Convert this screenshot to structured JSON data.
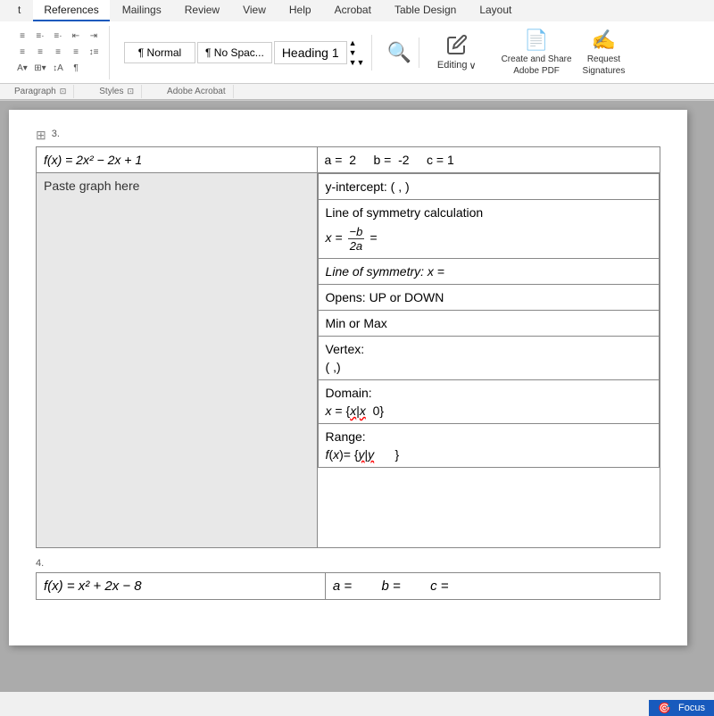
{
  "ribbon": {
    "tabs": [
      {
        "label": "t",
        "active": false
      },
      {
        "label": "References",
        "active": true
      },
      {
        "label": "Mailings",
        "active": false
      },
      {
        "label": "Review",
        "active": false
      },
      {
        "label": "View",
        "active": false
      },
      {
        "label": "Help",
        "active": false
      },
      {
        "label": "Acrobat",
        "active": false
      },
      {
        "label": "Table Design",
        "active": false
      },
      {
        "label": "Layout",
        "active": false
      }
    ],
    "styles": {
      "normal": "¶ Normal",
      "nospace": "¶ No Spac...",
      "heading": "Heading 1"
    },
    "groups": {
      "paragraph_label": "Paragraph",
      "styles_label": "Styles",
      "acrobat_label": "Adobe Acrobat"
    },
    "editing": {
      "label": "Editing",
      "chevron": "∨"
    },
    "acrobat_buttons": [
      {
        "label": "Create and Share\nAdobe PDF",
        "icon": "📄"
      },
      {
        "label": "Request\nSignatures",
        "icon": "✍"
      }
    ]
  },
  "document": {
    "row3_label": "3.",
    "row4_label": "4.",
    "problem3": {
      "function": "f(x) = 2x² − 2x + 1",
      "a_label": "a =",
      "a_value": "2",
      "b_label": "b =",
      "b_value": "-2",
      "c_label": "c =",
      "c_value": "1",
      "paste_text": "Paste graph here",
      "y_intercept_label": "y-intercept: (       ,       )",
      "symmetry_calc_label": "Line of symmetry calculation",
      "symmetry_formula": "x =",
      "neg_b": "−b",
      "two_a": "2a",
      "equals": "=",
      "symmetry_result": "Line of symmetry: x =",
      "opens_label": "Opens: UP or DOWN",
      "minmax_label": "Min or Max",
      "vertex_label": "Vertex:",
      "vertex_coords": "(      ,)",
      "domain_label": "Domain:",
      "domain_value": "x = {x|x",
      "domain_suffix": "  0}",
      "range_label": "Range:",
      "range_value": "f(x)= {y|y",
      "range_suffix": "      }"
    },
    "problem4": {
      "function": "f(x) = x² + 2x − 8",
      "a_label": "a =",
      "b_label": "b =",
      "c_label": "c ="
    }
  },
  "statusbar": {
    "focus_label": "Focus"
  }
}
